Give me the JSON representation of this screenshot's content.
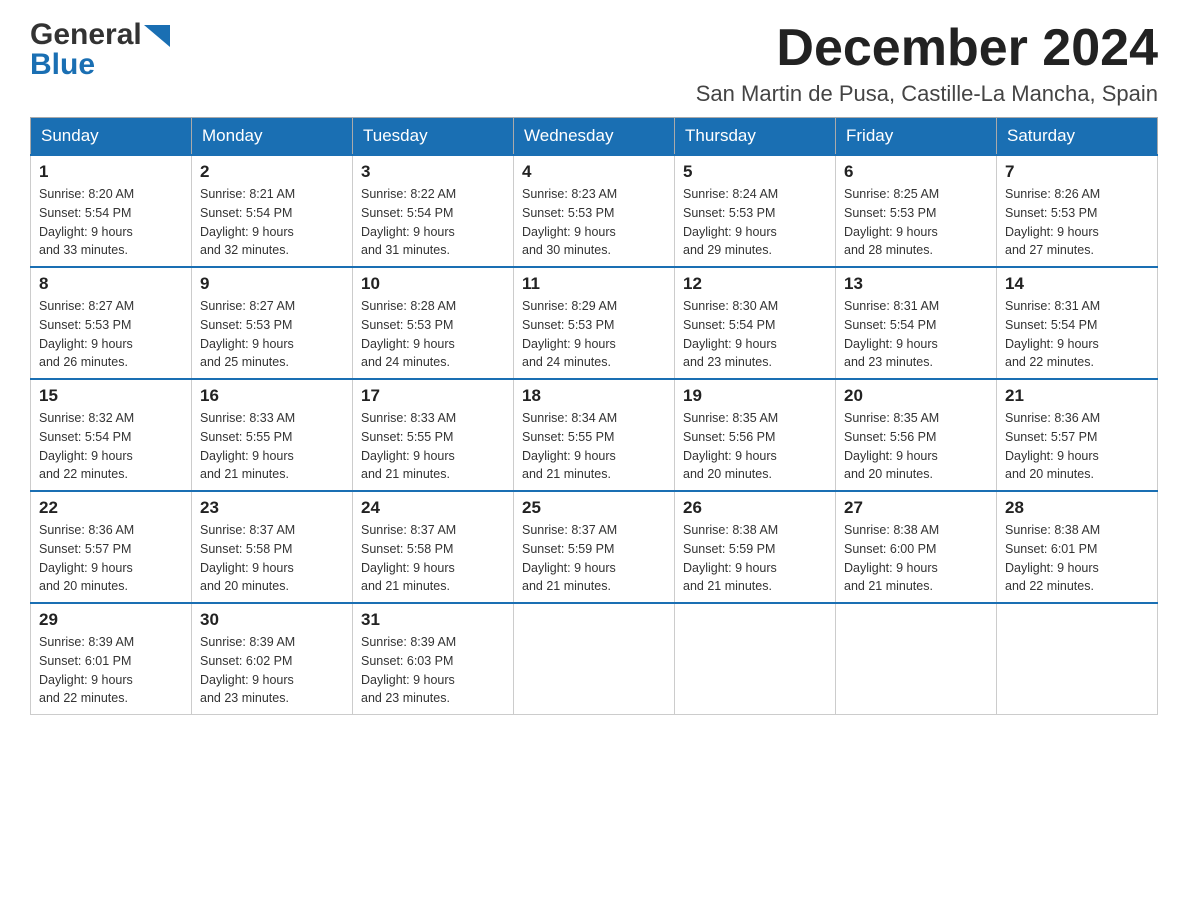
{
  "header": {
    "logo_general": "General",
    "logo_blue": "Blue",
    "month_title": "December 2024",
    "location": "San Martin de Pusa, Castille-La Mancha, Spain"
  },
  "days_of_week": [
    "Sunday",
    "Monday",
    "Tuesday",
    "Wednesday",
    "Thursday",
    "Friday",
    "Saturday"
  ],
  "weeks": [
    [
      {
        "date": "1",
        "sunrise": "8:20 AM",
        "sunset": "5:54 PM",
        "daylight": "9 hours and 33 minutes."
      },
      {
        "date": "2",
        "sunrise": "8:21 AM",
        "sunset": "5:54 PM",
        "daylight": "9 hours and 32 minutes."
      },
      {
        "date": "3",
        "sunrise": "8:22 AM",
        "sunset": "5:54 PM",
        "daylight": "9 hours and 31 minutes."
      },
      {
        "date": "4",
        "sunrise": "8:23 AM",
        "sunset": "5:53 PM",
        "daylight": "9 hours and 30 minutes."
      },
      {
        "date": "5",
        "sunrise": "8:24 AM",
        "sunset": "5:53 PM",
        "daylight": "9 hours and 29 minutes."
      },
      {
        "date": "6",
        "sunrise": "8:25 AM",
        "sunset": "5:53 PM",
        "daylight": "9 hours and 28 minutes."
      },
      {
        "date": "7",
        "sunrise": "8:26 AM",
        "sunset": "5:53 PM",
        "daylight": "9 hours and 27 minutes."
      }
    ],
    [
      {
        "date": "8",
        "sunrise": "8:27 AM",
        "sunset": "5:53 PM",
        "daylight": "9 hours and 26 minutes."
      },
      {
        "date": "9",
        "sunrise": "8:27 AM",
        "sunset": "5:53 PM",
        "daylight": "9 hours and 25 minutes."
      },
      {
        "date": "10",
        "sunrise": "8:28 AM",
        "sunset": "5:53 PM",
        "daylight": "9 hours and 24 minutes."
      },
      {
        "date": "11",
        "sunrise": "8:29 AM",
        "sunset": "5:53 PM",
        "daylight": "9 hours and 24 minutes."
      },
      {
        "date": "12",
        "sunrise": "8:30 AM",
        "sunset": "5:54 PM",
        "daylight": "9 hours and 23 minutes."
      },
      {
        "date": "13",
        "sunrise": "8:31 AM",
        "sunset": "5:54 PM",
        "daylight": "9 hours and 23 minutes."
      },
      {
        "date": "14",
        "sunrise": "8:31 AM",
        "sunset": "5:54 PM",
        "daylight": "9 hours and 22 minutes."
      }
    ],
    [
      {
        "date": "15",
        "sunrise": "8:32 AM",
        "sunset": "5:54 PM",
        "daylight": "9 hours and 22 minutes."
      },
      {
        "date": "16",
        "sunrise": "8:33 AM",
        "sunset": "5:55 PM",
        "daylight": "9 hours and 21 minutes."
      },
      {
        "date": "17",
        "sunrise": "8:33 AM",
        "sunset": "5:55 PM",
        "daylight": "9 hours and 21 minutes."
      },
      {
        "date": "18",
        "sunrise": "8:34 AM",
        "sunset": "5:55 PM",
        "daylight": "9 hours and 21 minutes."
      },
      {
        "date": "19",
        "sunrise": "8:35 AM",
        "sunset": "5:56 PM",
        "daylight": "9 hours and 20 minutes."
      },
      {
        "date": "20",
        "sunrise": "8:35 AM",
        "sunset": "5:56 PM",
        "daylight": "9 hours and 20 minutes."
      },
      {
        "date": "21",
        "sunrise": "8:36 AM",
        "sunset": "5:57 PM",
        "daylight": "9 hours and 20 minutes."
      }
    ],
    [
      {
        "date": "22",
        "sunrise": "8:36 AM",
        "sunset": "5:57 PM",
        "daylight": "9 hours and 20 minutes."
      },
      {
        "date": "23",
        "sunrise": "8:37 AM",
        "sunset": "5:58 PM",
        "daylight": "9 hours and 20 minutes."
      },
      {
        "date": "24",
        "sunrise": "8:37 AM",
        "sunset": "5:58 PM",
        "daylight": "9 hours and 21 minutes."
      },
      {
        "date": "25",
        "sunrise": "8:37 AM",
        "sunset": "5:59 PM",
        "daylight": "9 hours and 21 minutes."
      },
      {
        "date": "26",
        "sunrise": "8:38 AM",
        "sunset": "5:59 PM",
        "daylight": "9 hours and 21 minutes."
      },
      {
        "date": "27",
        "sunrise": "8:38 AM",
        "sunset": "6:00 PM",
        "daylight": "9 hours and 21 minutes."
      },
      {
        "date": "28",
        "sunrise": "8:38 AM",
        "sunset": "6:01 PM",
        "daylight": "9 hours and 22 minutes."
      }
    ],
    [
      {
        "date": "29",
        "sunrise": "8:39 AM",
        "sunset": "6:01 PM",
        "daylight": "9 hours and 22 minutes."
      },
      {
        "date": "30",
        "sunrise": "8:39 AM",
        "sunset": "6:02 PM",
        "daylight": "9 hours and 23 minutes."
      },
      {
        "date": "31",
        "sunrise": "8:39 AM",
        "sunset": "6:03 PM",
        "daylight": "9 hours and 23 minutes."
      },
      null,
      null,
      null,
      null
    ]
  ],
  "labels": {
    "sunrise": "Sunrise:",
    "sunset": "Sunset:",
    "daylight": "Daylight:"
  }
}
